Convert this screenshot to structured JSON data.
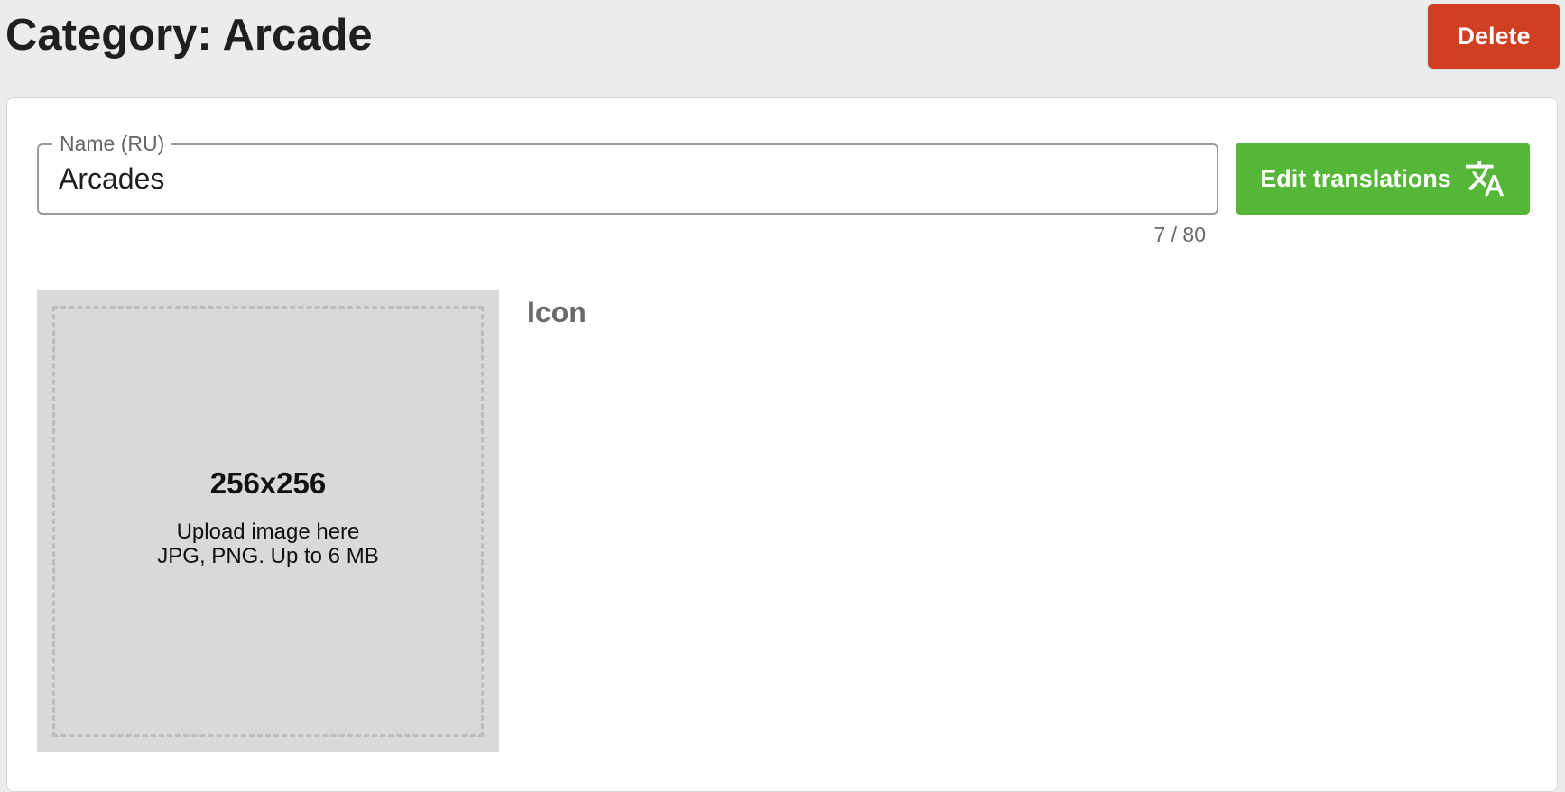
{
  "header": {
    "title": "Category: Arcade",
    "delete_label": "Delete"
  },
  "form": {
    "name_label": "Name (RU)",
    "name_value": "Arcades",
    "char_counter": "7 / 80",
    "edit_translations_label": "Edit translations",
    "edit_translations_icon": "translate-icon"
  },
  "upload": {
    "size": "256x256",
    "hint": "Upload image here",
    "formats": "JPG, PNG. Up to 6 MB"
  },
  "icon_section": {
    "label": "Icon"
  },
  "colors": {
    "delete": "#d13f23",
    "edit_translations": "#55b737",
    "page_background": "#ececec",
    "upload_background": "#d9d9d9"
  }
}
